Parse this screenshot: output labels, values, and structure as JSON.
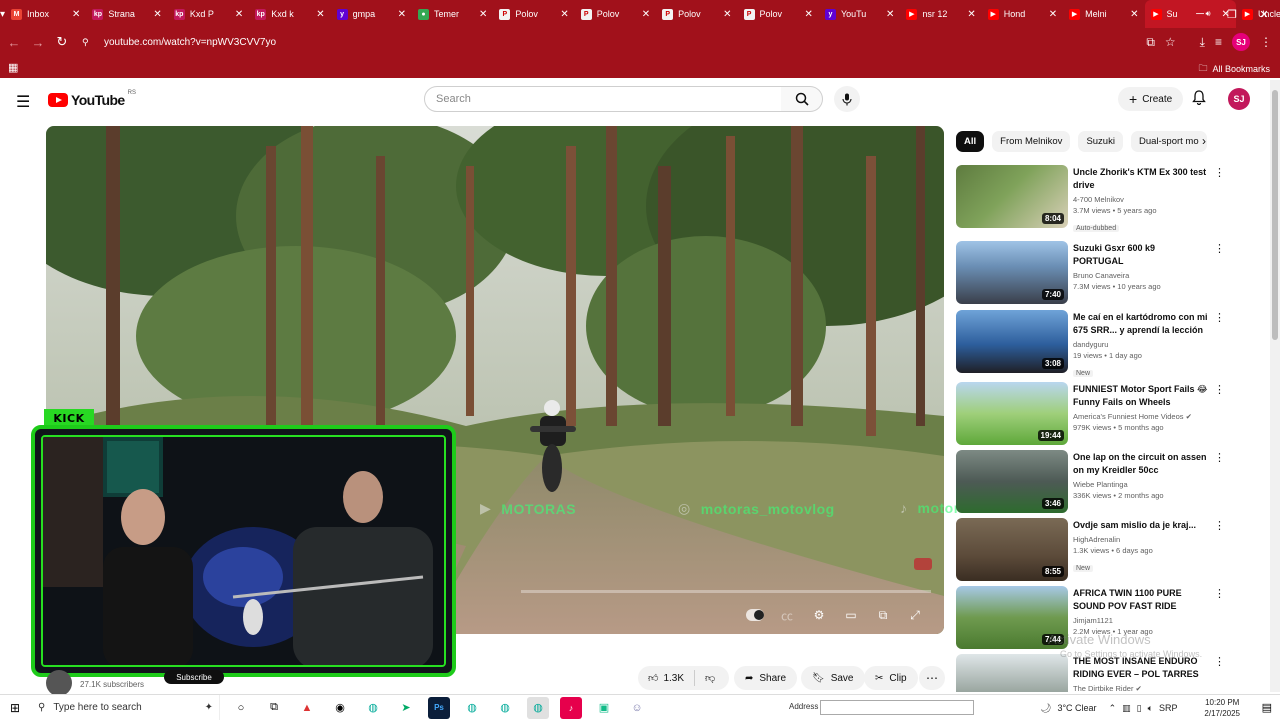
{
  "browser": {
    "tabs": [
      {
        "label": "Inbox",
        "icon": "gmail-icon",
        "color": "#ea4335",
        "glyph": "M"
      },
      {
        "label": "Strana",
        "icon": "kp-icon",
        "color": "#c2185b",
        "glyph": "kp"
      },
      {
        "label": "Kxd P",
        "icon": "kp-icon",
        "color": "#c2185b",
        "glyph": "kp"
      },
      {
        "label": "Kxd k",
        "icon": "kp-icon",
        "color": "#c2185b",
        "glyph": "kp"
      },
      {
        "label": "gmpa",
        "icon": "yahoo-icon",
        "color": "#6001d2",
        "glyph": "y"
      },
      {
        "label": "Temer",
        "icon": "maps-icon",
        "color": "#34a853",
        "glyph": "●"
      },
      {
        "label": "Polov",
        "icon": "polovni-icon",
        "color": "#f3f3f3",
        "glyph": "P"
      },
      {
        "label": "Polov",
        "icon": "polovni-icon",
        "color": "#f3f3f3",
        "glyph": "P"
      },
      {
        "label": "Polov",
        "icon": "polovni-icon",
        "color": "#f3f3f3",
        "glyph": "P"
      },
      {
        "label": "Polov",
        "icon": "polovni-icon",
        "color": "#f3f3f3",
        "glyph": "P"
      },
      {
        "label": "YouTu",
        "icon": "yahoo-icon",
        "color": "#6001d2",
        "glyph": "y"
      },
      {
        "label": "nsr 12",
        "icon": "youtube-icon",
        "color": "#ff0000",
        "glyph": "▶"
      },
      {
        "label": "Hond",
        "icon": "youtube-icon",
        "color": "#ff0000",
        "glyph": "▶"
      },
      {
        "label": "Melni",
        "icon": "youtube-icon",
        "color": "#ff0000",
        "glyph": "▶"
      },
      {
        "label": "Su",
        "icon": "youtube-icon",
        "color": "#ff0000",
        "glyph": "▶",
        "active": true
      },
      {
        "label": "Uncle",
        "icon": "youtube-icon",
        "color": "#ff0000",
        "glyph": "▶"
      }
    ],
    "url": "youtube.com/watch?v=npWV3CVV7yo",
    "all_bookmarks": "All Bookmarks",
    "profile_initials": "SJ",
    "chrome_color": "#a1111b"
  },
  "header": {
    "logo_text": "YouTube",
    "logo_suffix": "RS",
    "search_placeholder": "Search",
    "create_label": "Create",
    "avatar_initials": "SJ"
  },
  "player": {
    "kick_label": "KICK",
    "watermarks": [
      "MOTORAS",
      "motoras_motovlog",
      "motoras27"
    ],
    "progress": 0.0
  },
  "below": {
    "subscribers": "27.1K subscribers",
    "subscribe_label": "Subscribe",
    "likes": "1.3K",
    "share": "Share",
    "save": "Save",
    "clip": "Clip"
  },
  "sidebar": {
    "chips": [
      "All",
      "From Melnikov",
      "Suzuki",
      "Dual-sport mo"
    ],
    "recommendations": [
      {
        "title": "Uncle Zhorik's KTM Ex 300 test drive",
        "channel": "4-700 Melnikov",
        "meta": "3.7M views • 5 years ago",
        "badge": "Auto-dubbed",
        "duration": "8:04",
        "thumb": "ktm"
      },
      {
        "title": "Suzuki Gsxr 600 k9 PORTUGAL",
        "channel": "Bruno Canaveira",
        "meta": "7.3M views • 10 years ago",
        "badge": "",
        "duration": "7:40",
        "thumb": "gsxr"
      },
      {
        "title": "Me caí en el kartódromo con mi 675 SRR... y aprendí la lección",
        "channel": "dandyguru",
        "meta": "19 views • 1 day ago",
        "badge": "New",
        "duration": "3:08",
        "thumb": "kart"
      },
      {
        "title": "FUNNIEST Motor Sport Fails 😂 Funny Fails on Wheels",
        "channel": "America's Funniest Home Videos ✔",
        "meta": "979K views • 5 months ago",
        "badge": "",
        "duration": "19:44",
        "thumb": "fails"
      },
      {
        "title": "One lap on the circuit on assen on my Kreidler 50cc",
        "channel": "Wiebe Plantinga",
        "meta": "336K views • 2 months ago",
        "badge": "",
        "duration": "3:46",
        "thumb": "assen"
      },
      {
        "title": "Ovdje sam mislio da je kraj...",
        "channel": "HighAdrenalin",
        "meta": "1.3K views • 6 days ago",
        "badge": "New",
        "duration": "8:55",
        "thumb": "mud"
      },
      {
        "title": "AFRICA TWIN 1100 PURE SOUND POV FAST RIDE",
        "channel": "Jimjam1121",
        "meta": "2.2M views • 1 year ago",
        "badge": "",
        "duration": "7:44",
        "thumb": "africa"
      },
      {
        "title": "THE MOST INSANE ENDURO RIDING EVER – POL TARRES",
        "channel": "The Dirtbike Rider ✔",
        "meta": "",
        "badge": "",
        "duration": "",
        "thumb": "enduro"
      }
    ]
  },
  "os": {
    "activate_title": "Activate Windows",
    "activate_sub": "Go to Settings to activate Windows.",
    "taskbar_search": "Type here to search",
    "address_label": "Address",
    "weather": "3°C  Clear",
    "lang": "SRP",
    "time": "10:20 PM",
    "date": "2/17/2025"
  }
}
